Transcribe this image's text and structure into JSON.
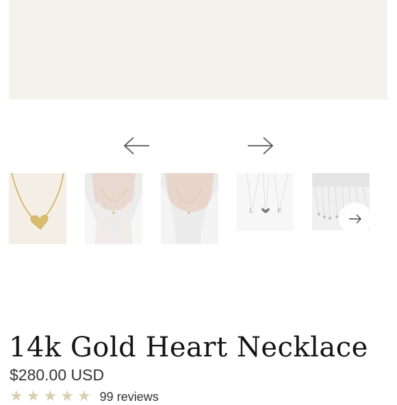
{
  "product": {
    "title": "14k Gold Heart Necklace",
    "price": "$280.00 USD",
    "rating": {
      "value_out_of_5": 5,
      "stars_icon": "star-icon"
    },
    "review_count": "99 reviews"
  },
  "gallery": {
    "prev_icon": "arrow-left-icon",
    "next_icon": "arrow-right-icon",
    "thumbnails": [
      {
        "label": "",
        "icon": "necklace-heart-closeup"
      },
      {
        "label": "",
        "icon": "model-wearing-necklace"
      },
      {
        "label": "",
        "icon": "model-wearing-necklace"
      },
      {
        "label": "L ♥ E",
        "icon": "initial-necklaces"
      },
      {
        "label": "",
        "icon": "necklace-display-rack"
      }
    ],
    "carousel_next_icon": "chevron-right-icon"
  },
  "colors": {
    "hero_background": "#f5f2ec",
    "gold": "#d4b25a",
    "star": "#d8cfae"
  }
}
